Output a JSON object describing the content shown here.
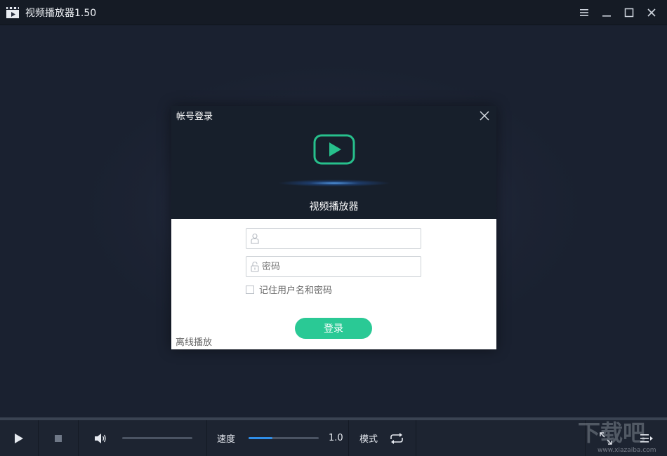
{
  "window": {
    "title": "视频播放器1.50",
    "controls": [
      "menu-icon",
      "minimize-icon",
      "maximize-icon",
      "close-icon"
    ]
  },
  "dialog": {
    "title": "帐号登录",
    "app_name": "视频播放器",
    "username": {
      "value": "",
      "placeholder": ""
    },
    "password": {
      "value": "",
      "placeholder": "密码"
    },
    "remember_label": "记住用户名和密码",
    "remember_checked": false,
    "login_button": "登录",
    "offline_link": "离线播放",
    "accent_color": "#2ac995"
  },
  "controls": {
    "volume_level": 0,
    "speed_label": "速度",
    "speed_fraction": 0.34,
    "speed_value": "1.0",
    "mode_label": "模式",
    "progress_fraction": 0
  },
  "watermark": {
    "brand": "下载吧",
    "url": "www.xiazaiba.com"
  }
}
